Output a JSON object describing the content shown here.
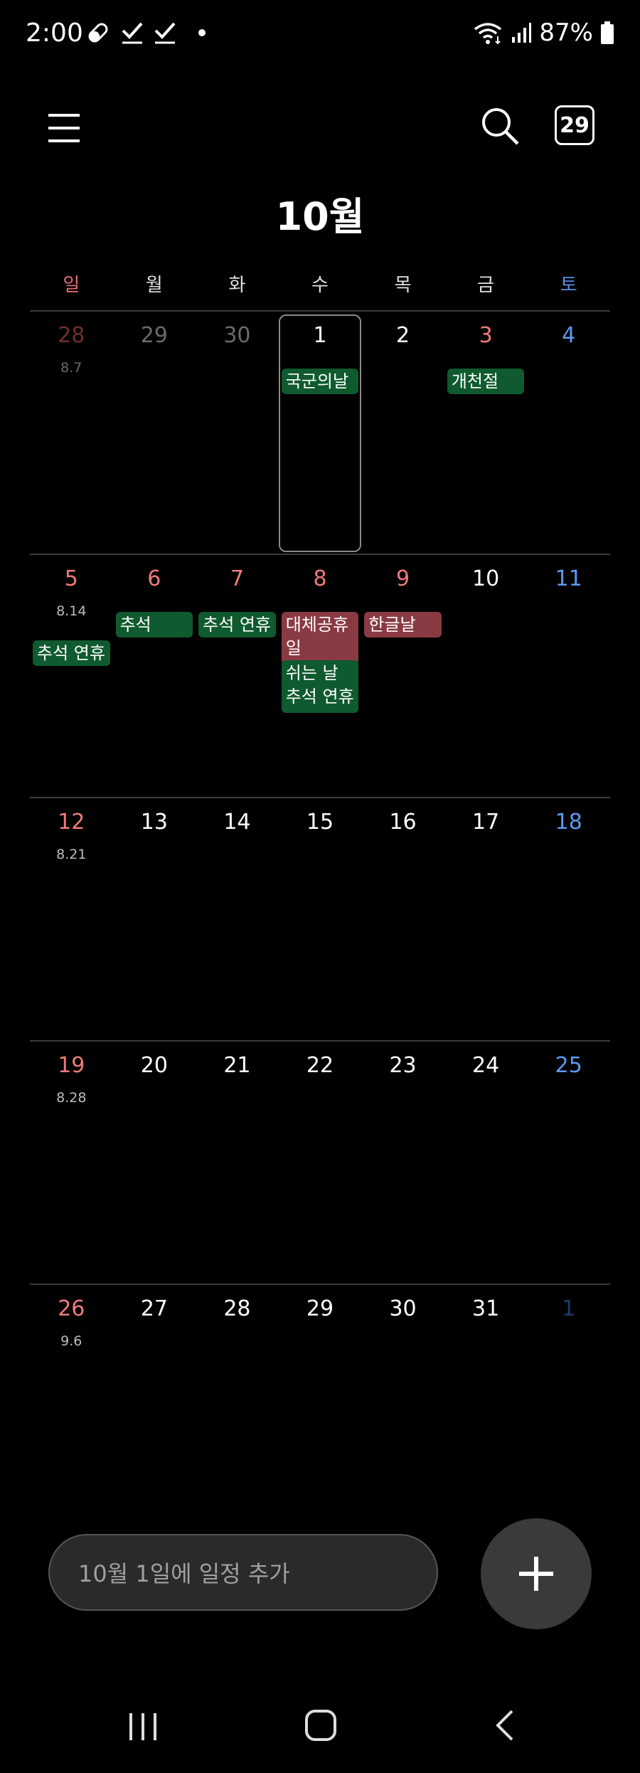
{
  "status_bar": {
    "time": "2:00",
    "battery": "87%",
    "icons": [
      "pill-icon",
      "check-icon",
      "check-icon",
      "dot-icon",
      "wifi-icon",
      "signal-icon",
      "battery-icon"
    ]
  },
  "app_bar": {
    "today_badge": "29"
  },
  "month_title": "10월",
  "weekdays": [
    "일",
    "월",
    "화",
    "수",
    "목",
    "금",
    "토"
  ],
  "weeks": [
    {
      "days": [
        {
          "num": "28",
          "style": "dim-sun",
          "lunar": "8.7",
          "lunar_dim": true
        },
        {
          "num": "29",
          "style": "dim"
        },
        {
          "num": "30",
          "style": "dim"
        },
        {
          "num": "1",
          "style": "normal"
        },
        {
          "num": "2",
          "style": "normal"
        },
        {
          "num": "3",
          "style": "sun"
        },
        {
          "num": "4",
          "style": "sat"
        }
      ],
      "events": [
        {
          "label": "국군의날",
          "col": 3,
          "row": 0,
          "color": "green"
        },
        {
          "label": "개천절",
          "col": 5,
          "row": 0,
          "color": "green"
        }
      ]
    },
    {
      "days": [
        {
          "num": "5",
          "style": "sun",
          "lunar": "8.14"
        },
        {
          "num": "6",
          "style": "sun"
        },
        {
          "num": "7",
          "style": "sun"
        },
        {
          "num": "8",
          "style": "sun"
        },
        {
          "num": "9",
          "style": "sun"
        },
        {
          "num": "10",
          "style": "normal"
        },
        {
          "num": "11",
          "style": "sat"
        }
      ],
      "events": [
        {
          "label": "추석",
          "col": 1,
          "row": 0,
          "color": "green"
        },
        {
          "label": "추석 연휴",
          "col": 2,
          "row": 0,
          "color": "green"
        },
        {
          "label": "대체공휴일",
          "col": 3,
          "row": 0,
          "color": "red",
          "tall": true
        },
        {
          "label": "한글날",
          "col": 4,
          "row": 0,
          "color": "red"
        },
        {
          "label": "추석 연휴",
          "col": 0,
          "row": 1,
          "color": "green"
        },
        {
          "label": "쉬는 날 추석 연휴",
          "col": 3,
          "row": 2,
          "color": "green",
          "tall": true
        }
      ]
    },
    {
      "days": [
        {
          "num": "12",
          "style": "sun",
          "lunar": "8.21"
        },
        {
          "num": "13",
          "style": "normal"
        },
        {
          "num": "14",
          "style": "normal"
        },
        {
          "num": "15",
          "style": "normal"
        },
        {
          "num": "16",
          "style": "normal"
        },
        {
          "num": "17",
          "style": "normal"
        },
        {
          "num": "18",
          "style": "sat"
        }
      ],
      "events": []
    },
    {
      "days": [
        {
          "num": "19",
          "style": "sun",
          "lunar": "8.28"
        },
        {
          "num": "20",
          "style": "normal"
        },
        {
          "num": "21",
          "style": "normal"
        },
        {
          "num": "22",
          "style": "normal"
        },
        {
          "num": "23",
          "style": "normal"
        },
        {
          "num": "24",
          "style": "normal"
        },
        {
          "num": "25",
          "style": "sat"
        }
      ],
      "events": []
    },
    {
      "days": [
        {
          "num": "26",
          "style": "sun",
          "lunar": "9.6"
        },
        {
          "num": "27",
          "style": "normal"
        },
        {
          "num": "28",
          "style": "normal"
        },
        {
          "num": "29",
          "style": "normal"
        },
        {
          "num": "30",
          "style": "normal"
        },
        {
          "num": "31",
          "style": "normal"
        },
        {
          "num": "1",
          "style": "dim-sat"
        }
      ],
      "events": []
    }
  ],
  "selected": {
    "week": 0,
    "col": 3
  },
  "add_bar": {
    "placeholder": "10월 1일에 일정 추가"
  },
  "colors": {
    "event_green": "#0f5a2e",
    "event_red": "#8a3a43",
    "sunday": "#ef7a7a",
    "saturday": "#5b9af0"
  }
}
